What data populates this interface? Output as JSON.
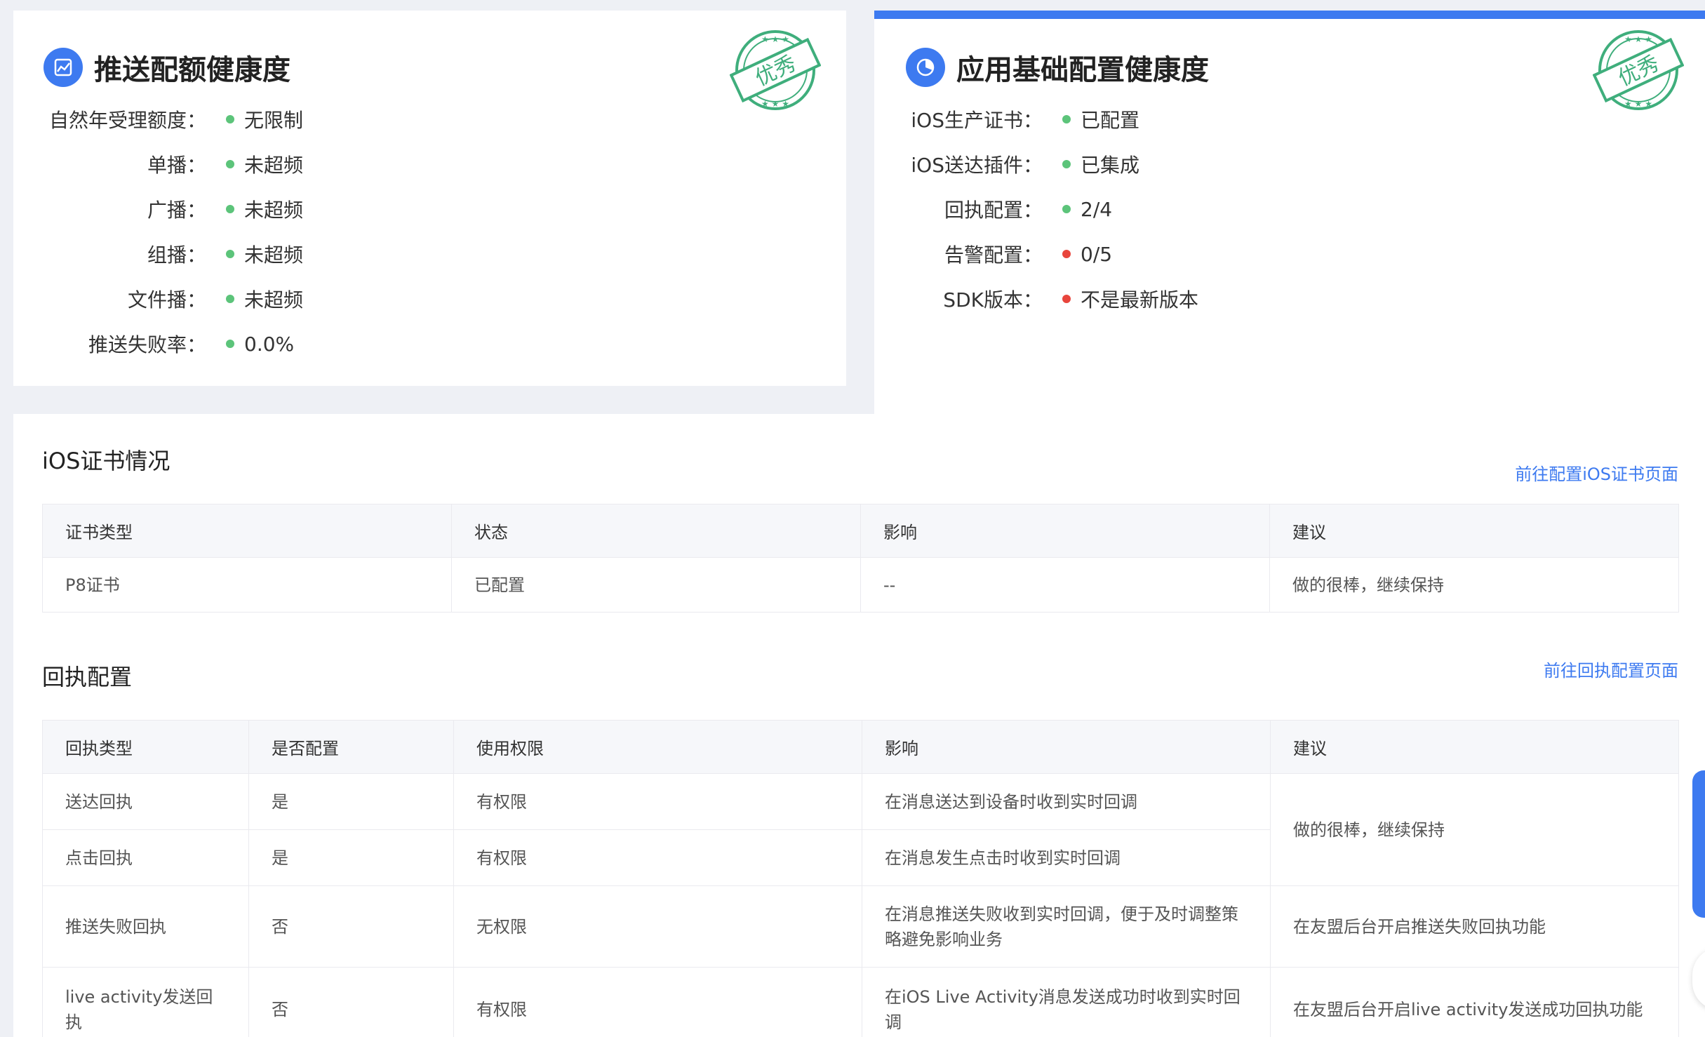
{
  "push_quota": {
    "title": "推送配额健康度",
    "stamp_text": "优秀",
    "rows": [
      {
        "label": "自然年受理额度：",
        "value": "无限制",
        "status": "green"
      },
      {
        "label": "单播：",
        "value": "未超频",
        "status": "green"
      },
      {
        "label": "广播：",
        "value": "未超频",
        "status": "green"
      },
      {
        "label": "组播：",
        "value": "未超频",
        "status": "green"
      },
      {
        "label": "文件播：",
        "value": "未超频",
        "status": "green"
      },
      {
        "label": "推送失败率：",
        "value": "0.0%",
        "status": "green"
      }
    ]
  },
  "app_config": {
    "title": "应用基础配置健康度",
    "stamp_text": "优秀",
    "rows": [
      {
        "label": "iOS生产证书：",
        "value": "已配置",
        "status": "green"
      },
      {
        "label": "iOS送达插件：",
        "value": "已集成",
        "status": "green"
      },
      {
        "label": "回执配置：",
        "value": "2/4",
        "status": "green"
      },
      {
        "label": "告警配置：",
        "value": "0/5",
        "status": "red"
      },
      {
        "label": "SDK版本：",
        "value": "不是最新版本",
        "status": "red"
      }
    ]
  },
  "ios_cert": {
    "title": "iOS证书情况",
    "link": "前往配置iOS证书页面",
    "headers": [
      "证书类型",
      "状态",
      "影响",
      "建议"
    ],
    "rows": [
      [
        "P8证书",
        "已配置",
        "--",
        "做的很棒，继续保持"
      ]
    ]
  },
  "receipt": {
    "title": "回执配置",
    "link": "前往回执配置页面",
    "headers": [
      "回执类型",
      "是否配置",
      "使用权限",
      "影响",
      "建议"
    ],
    "rows": [
      [
        "送达回执",
        "是",
        "有权限",
        "在消息送达到设备时收到实时回调"
      ],
      [
        "点击回执",
        "是",
        "有权限",
        "在消息发生点击时收到实时回调"
      ],
      [
        "推送失败回执",
        "否",
        "无权限",
        "在消息推送失败收到实时回调，便于及时调整策略避免影响业务",
        "在友盟后台开启推送失败回执功能"
      ],
      [
        "live activity发送回执",
        "否",
        "有权限",
        "在iOS Live Activity消息发送成功时收到实时回调",
        "在友盟后台开启live activity发送成功回执功能"
      ]
    ],
    "merged_suggestion": "做的很棒，继续保持"
  },
  "colors": {
    "accent": "#3d7af0",
    "ok": "#5cc47a",
    "bad": "#e8453c",
    "stamp": "#3fae7c"
  }
}
